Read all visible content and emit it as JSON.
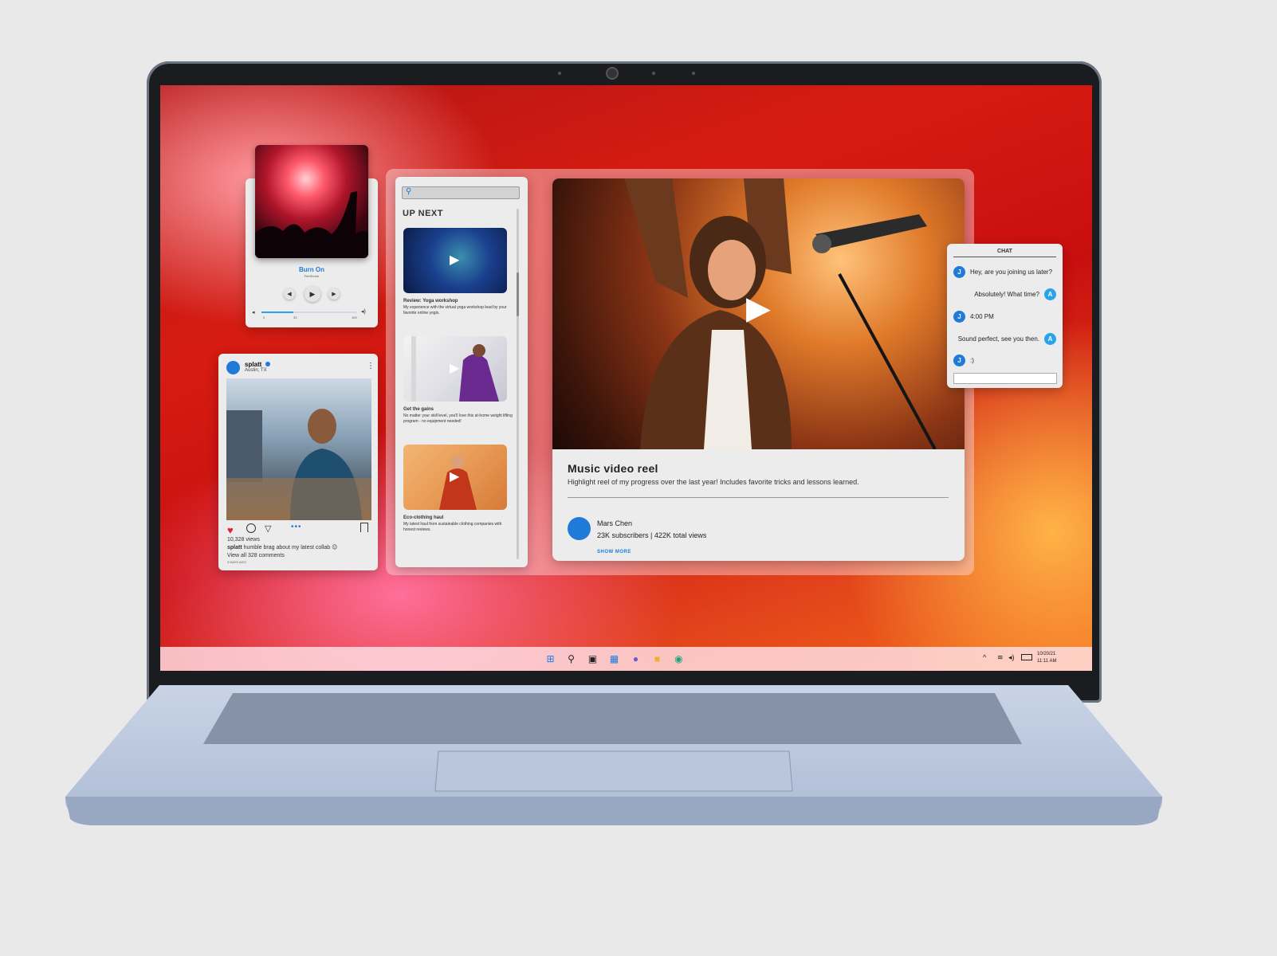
{
  "music_player": {
    "song_title": "Burn On",
    "artist": "FireShrine",
    "time_start": "0",
    "time_mid": "33",
    "time_end": "100",
    "progress": 0.33
  },
  "social_post": {
    "username": "splatt",
    "location": "Austin, TX",
    "views": "10,328 views",
    "caption_user": "splatt",
    "caption_text": "humble brag about my latest collab 😉",
    "comments_link": "View all 328 comments",
    "age": "3 DAYS AGO"
  },
  "up_next": {
    "search_placeholder": "",
    "heading": "UP NEXT",
    "items": [
      {
        "title": "Review: Yoga workshop",
        "desc": "My experience with the virtual yoga workshop lead by your favorite online yogis."
      },
      {
        "title": "Get the gains",
        "desc": "No matter your skill level, you'll love this at-home weight lifting program - no equipment needed!"
      },
      {
        "title": "Eco-clothing haul",
        "desc": "My latest haul from sustainable clothing companies with honest reviews."
      }
    ]
  },
  "video": {
    "title": "Music video reel",
    "description": "Highlight reel of my progress over the last year! Includes favorite tricks and lessons learned.",
    "channel_name": "Mars Chen",
    "channel_stats": "23K subscribers | 422K total views",
    "show_more": "SHOW MORE"
  },
  "chat": {
    "heading": "CHAT",
    "messages": [
      {
        "from": "J",
        "text": "Hey, are you joining us later?"
      },
      {
        "from": "A",
        "text": "Absolutely! What time?"
      },
      {
        "from": "J",
        "text": "4:00 PM"
      },
      {
        "from": "A",
        "text": "Sound perfect, see you then."
      },
      {
        "from": "J",
        "text": ":)"
      }
    ]
  },
  "taskbar": {
    "date": "10/20/21",
    "time": "11:11 AM"
  },
  "colors": {
    "accent": "#1f7ad8",
    "heart": "#e0202a"
  }
}
